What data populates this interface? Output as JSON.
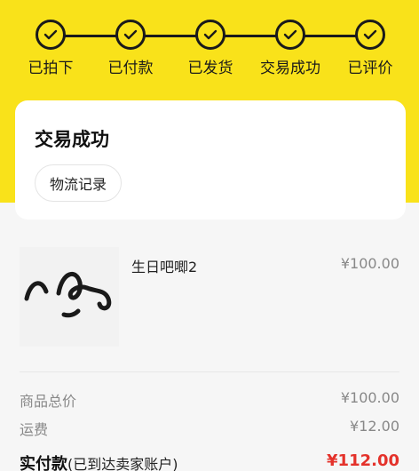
{
  "progress": {
    "steps": [
      {
        "label": "已拍下",
        "done": true
      },
      {
        "label": "已付款",
        "done": true
      },
      {
        "label": "已发货",
        "done": true
      },
      {
        "label": "交易成功",
        "done": true
      },
      {
        "label": "已评价",
        "done": true
      }
    ]
  },
  "status": {
    "title": "交易成功",
    "logistics_button": "物流记录"
  },
  "product": {
    "title": "生日吧唧2",
    "price": "¥100.00"
  },
  "summary": {
    "goods_total_label": "商品总价",
    "goods_total_value": "¥100.00",
    "shipping_label": "运费",
    "shipping_value": "¥12.00",
    "paid_label": "实付款",
    "paid_note": "(已到达卖家账户)",
    "paid_value": "¥112.00"
  },
  "colors": {
    "brand_yellow": "#f9e21a",
    "price_red": "#e4322b"
  }
}
